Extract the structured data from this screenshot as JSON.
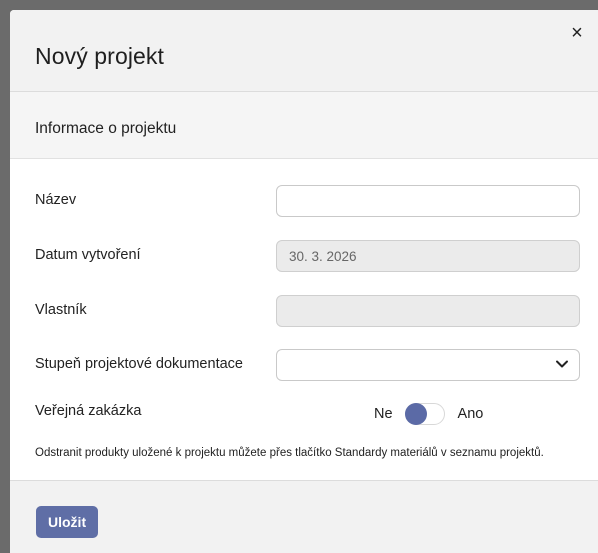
{
  "modal": {
    "title": "Nový projekt",
    "close_glyph": "×"
  },
  "section": {
    "title": "Informace o projektu"
  },
  "form": {
    "name_label": "Název",
    "name_value": "",
    "date_label": "Datum vytvoření",
    "date_value": "30. 3. 2026",
    "owner_label": "Vlastník",
    "owner_value": "",
    "stage_label": "Stupeň projektové dokumentace",
    "stage_value": "",
    "public_label": "Veřejná zakázka",
    "toggle_off_label": "Ne",
    "toggle_on_label": "Ano",
    "toggle_state": "off"
  },
  "note": "Odstranit produkty uložené k projektu můžete přes tlačítko Standardy materiálů v seznamu projektů.",
  "footer": {
    "save_label": "Uložit"
  },
  "colors": {
    "accent": "#5f6ea6",
    "overlay": "#6b6b6b",
    "header_bg": "#f2f2f2"
  },
  "icons": [
    "close-icon",
    "chevron-down-icon"
  ]
}
